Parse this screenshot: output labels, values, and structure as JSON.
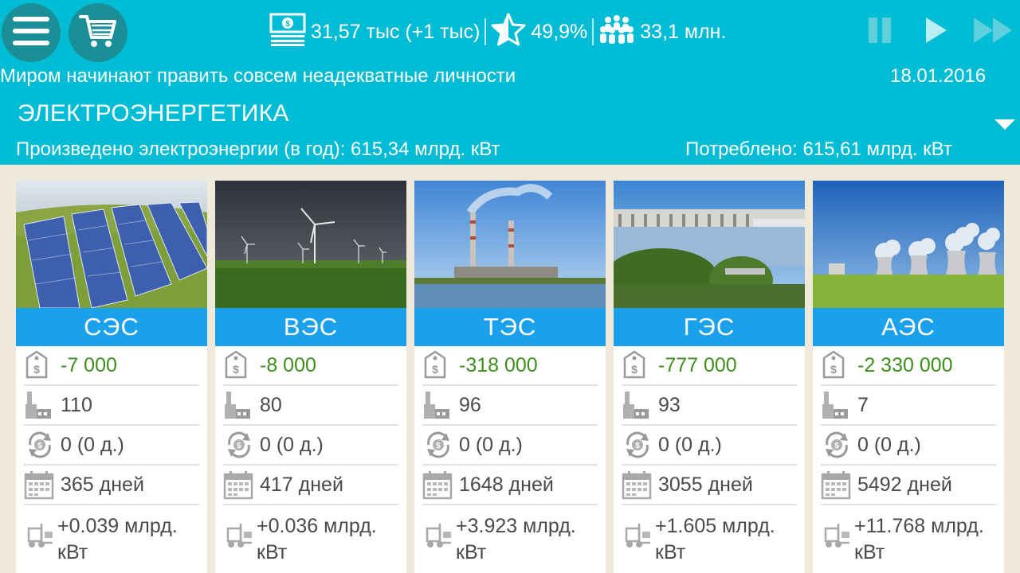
{
  "topbar": {
    "money": "31,57 тыс (+1 тыс)",
    "rating": "49,9%",
    "population": "33,1 млн.",
    "icons": [
      "menu-icon",
      "cart-icon",
      "money-icon",
      "star-icon",
      "people-icon",
      "pause-icon",
      "play-icon",
      "fast-forward-icon"
    ]
  },
  "news": "Миром начинают править совсем неадекватные личности",
  "date": "18.01.2016",
  "section": {
    "title": "ЭЛЕКТРОЭНЕРГЕТИКА",
    "produced": "Произведено электроэнергии (в год): 615,34 млрд. кВт",
    "consumed": "Потреблено: 615,61 млрд. кВт"
  },
  "colors": {
    "header": "#00bcd4",
    "card_title": "#1ba1ec",
    "cost_text": "#3d8f1c",
    "background": "#efe9d9"
  },
  "cards": [
    {
      "title": "СЭС",
      "cost": "-7 000",
      "count": "110",
      "upgrade": "0 (0 д.)",
      "days": "365 дней",
      "output_1": "+0.039 млрд.",
      "output_2": "кВт"
    },
    {
      "title": "ВЭС",
      "cost": "-8 000",
      "count": "80",
      "upgrade": "0 (0 д.)",
      "days": "417 дней",
      "output_1": "+0.036 млрд.",
      "output_2": "кВт"
    },
    {
      "title": "ТЭС",
      "cost": "-318 000",
      "count": "96",
      "upgrade": "0 (0 д.)",
      "days": "1648 дней",
      "output_1": "+3.923 млрд.",
      "output_2": "кВт"
    },
    {
      "title": "ГЭС",
      "cost": "-777 000",
      "count": "93",
      "upgrade": "0 (0 д.)",
      "days": "3055 дней",
      "output_1": "+1.605 млрд.",
      "output_2": "кВт"
    },
    {
      "title": "АЭС",
      "cost": "-2 330 000",
      "count": "7",
      "upgrade": "0 (0 д.)",
      "days": "5492 дней",
      "output_1": "+11.768 млрд.",
      "output_2": "кВт"
    }
  ]
}
